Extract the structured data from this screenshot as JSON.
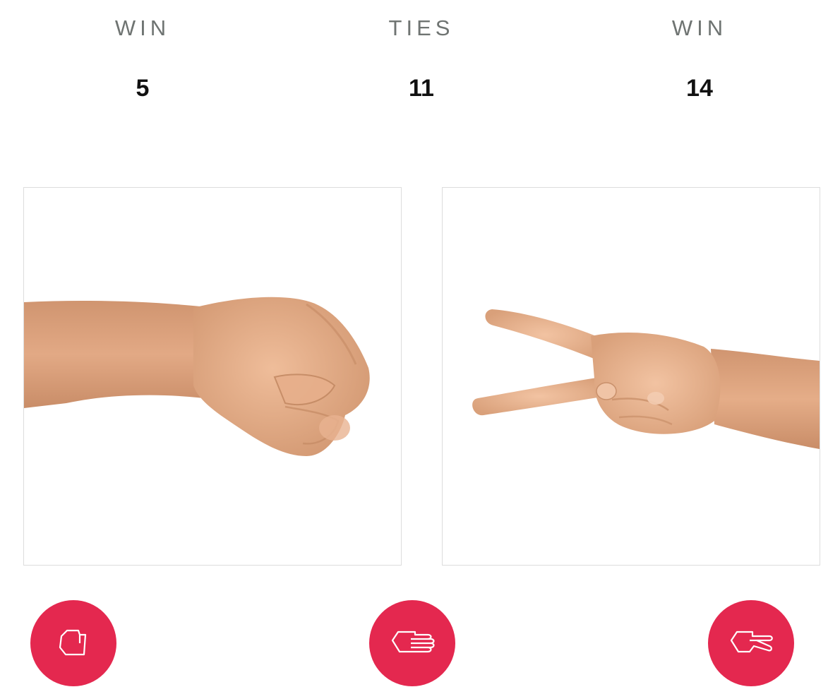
{
  "scoreboard": {
    "player": {
      "label": "WIN",
      "value": "5"
    },
    "ties": {
      "label": "TIES",
      "value": "11"
    },
    "computer": {
      "label": "WIN",
      "value": "14"
    }
  },
  "player_hand": {
    "choice": "rock"
  },
  "computer_hand": {
    "choice": "scissors"
  },
  "controls": {
    "rock": {
      "icon": "fist-icon"
    },
    "paper": {
      "icon": "open-hand-icon"
    },
    "scissors": {
      "icon": "two-fingers-icon"
    }
  },
  "colors": {
    "accent": "#e4284f",
    "label": "#6f7472",
    "skin": "#e0a882",
    "panel_border": "#dddddd"
  }
}
